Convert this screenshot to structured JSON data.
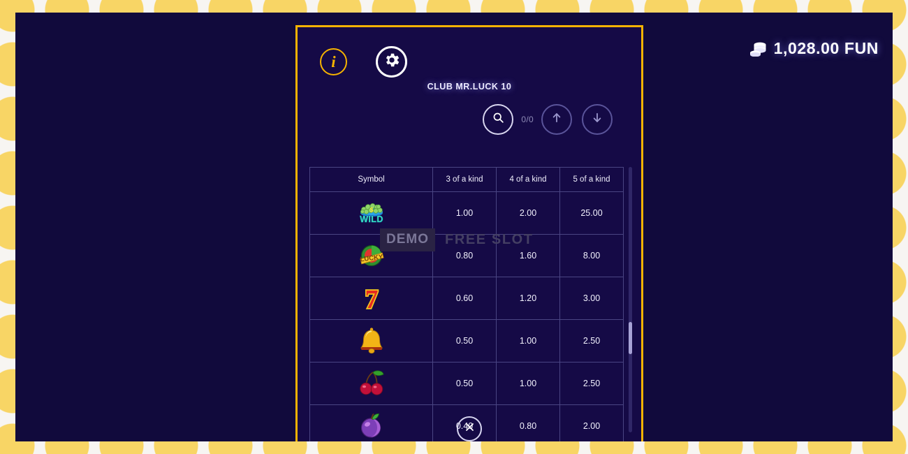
{
  "theme": {
    "page_bg": "#f7f5f2",
    "pattern_dot": "#f8d565",
    "stage_bg": "#110a3c",
    "frame_bg": "#150a46",
    "frame_border": "#f5b301",
    "accent_gold": "#f5b301",
    "grid_line": "#4a4583",
    "text": "#ffffff",
    "muted_text": "#8e8bb6"
  },
  "balance": {
    "icon": "coin-stack-icon",
    "amount": "1,028.00",
    "currency": "FUN",
    "display": "1,028.00 FUN"
  },
  "game": {
    "title": "CLUB MR.LUCK 10",
    "info_icon": "info-icon",
    "info_label": "i",
    "settings_icon": "gear-icon",
    "close_icon": "close-icon"
  },
  "search": {
    "search_icon": "search-icon",
    "counter": "0/0",
    "prev_icon": "arrow-up-icon",
    "next_icon": "arrow-down-icon"
  },
  "watermark": {
    "demo": "DEMO",
    "free_slot": "FREE SLOT"
  },
  "paytable": {
    "columns": [
      "Symbol",
      "3 of a kind",
      "4 of a kind",
      "5 of a kind"
    ],
    "rows": [
      {
        "symbol": "wild-money-symbol",
        "symbol_label": "WILD",
        "three": "1.00",
        "four": "2.00",
        "five": "25.00"
      },
      {
        "symbol": "lucky-melon-symbol",
        "symbol_label": "LUCKY",
        "three": "0.80",
        "four": "1.60",
        "five": "8.00"
      },
      {
        "symbol": "seven-symbol",
        "symbol_label": "7",
        "three": "0.60",
        "four": "1.20",
        "five": "3.00"
      },
      {
        "symbol": "bell-symbol",
        "symbol_label": "Bell",
        "three": "0.50",
        "four": "1.00",
        "five": "2.50"
      },
      {
        "symbol": "cherry-symbol",
        "symbol_label": "Cherries",
        "three": "0.50",
        "four": "1.00",
        "five": "2.50"
      },
      {
        "symbol": "plum-symbol",
        "symbol_label": "Plum",
        "three": "0.40",
        "four": "0.80",
        "five": "2.00"
      }
    ]
  }
}
